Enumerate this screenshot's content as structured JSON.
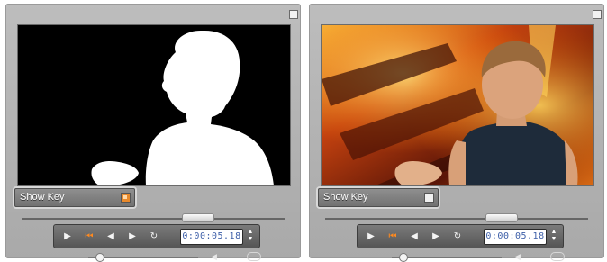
{
  "panels": [
    {
      "id": "left",
      "show_key": {
        "label": "Show Key",
        "checked": true
      },
      "timecode": "0:00:05.18"
    },
    {
      "id": "right",
      "show_key": {
        "label": "Show Key",
        "checked": false
      },
      "timecode": "0:00:05.18"
    }
  ],
  "transport_icons": [
    "play-icon",
    "go-to-start-icon",
    "step-back-icon",
    "step-forward-icon",
    "loop-icon"
  ],
  "colors": {
    "panel_bg": "#b3b3b3",
    "accent": "#ff8a1f",
    "timecode_text": "#3d5fa8"
  }
}
